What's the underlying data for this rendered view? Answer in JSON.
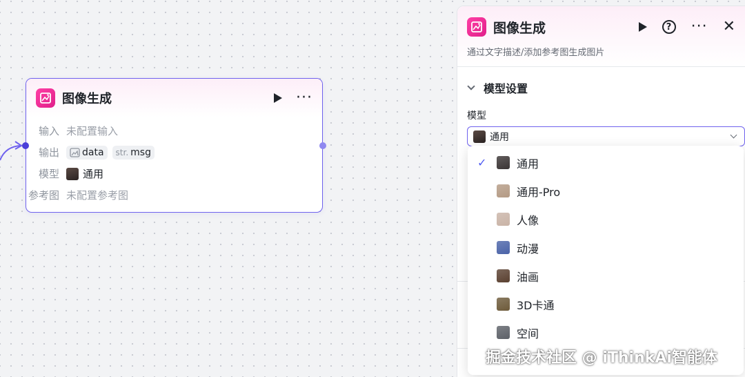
{
  "node": {
    "title": "图像生成",
    "rows": {
      "input_label": "输入",
      "input_value": "未配置输入",
      "output_label": "输出",
      "output_tags": [
        {
          "prefix": "",
          "name": "data"
        },
        {
          "prefix": "str.",
          "name": "msg"
        }
      ],
      "model_label": "模型",
      "model_value": "通用",
      "ref_label": "参考图",
      "ref_value": "未配置参考图"
    }
  },
  "panel": {
    "title": "图像生成",
    "description": "通过文字描述/添加参考图生成图片",
    "section_title": "模型设置",
    "model_field_label": "模型",
    "selected_model": "通用",
    "options": [
      {
        "label": "通用",
        "selected": true,
        "avatar_color": "#3a3434"
      },
      {
        "label": "通用-Pro",
        "selected": false,
        "avatar_color": "#b49a84"
      },
      {
        "label": "人像",
        "selected": false,
        "avatar_color": "#c9b3a6"
      },
      {
        "label": "动漫",
        "selected": false,
        "avatar_color": "#4a63a8"
      },
      {
        "label": "油画",
        "selected": false,
        "avatar_color": "#5a4030"
      },
      {
        "label": "3D卡通",
        "selected": false,
        "avatar_color": "#6d5a3a"
      },
      {
        "label": "空间",
        "selected": false,
        "avatar_color": "#5d6168"
      }
    ]
  },
  "watermark": "掘金技术社区 @ iThinkAi智能体",
  "colors": {
    "accent": "#6e61ee",
    "brand_pink": "#e0208a",
    "check": "#4e5bf2"
  }
}
